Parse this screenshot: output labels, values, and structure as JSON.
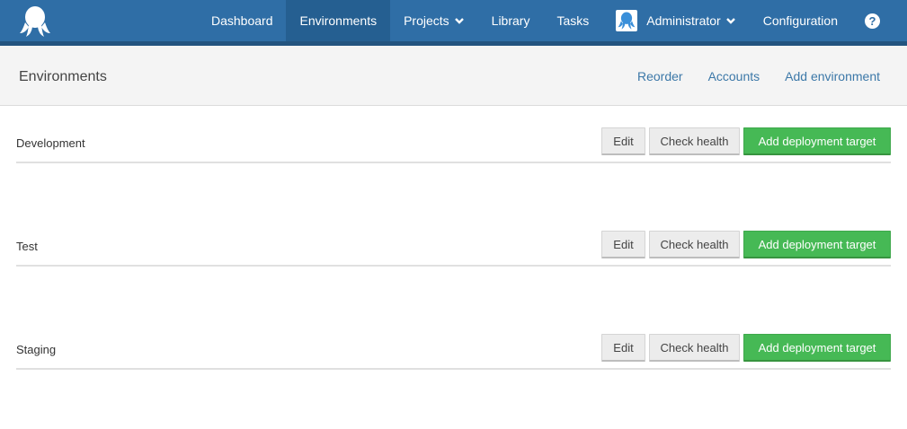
{
  "nav": {
    "items": [
      {
        "label": "Dashboard"
      },
      {
        "label": "Environments"
      },
      {
        "label": "Projects"
      },
      {
        "label": "Library"
      },
      {
        "label": "Tasks"
      },
      {
        "label": "Administrator"
      },
      {
        "label": "Configuration"
      }
    ],
    "help_label": "?",
    "active": "Environments"
  },
  "page": {
    "title": "Environments",
    "links": {
      "reorder": "Reorder",
      "accounts": "Accounts",
      "add_environment": "Add environment"
    }
  },
  "environments": [
    {
      "name": "Development",
      "edit": "Edit",
      "check_health": "Check health",
      "add_target": "Add deployment target"
    },
    {
      "name": "Test",
      "edit": "Edit",
      "check_health": "Check health",
      "add_target": "Add deployment target"
    },
    {
      "name": "Staging",
      "edit": "Edit",
      "check_health": "Check health",
      "add_target": "Add deployment target"
    }
  ],
  "colors": {
    "topbar": "#2f6ea6",
    "active_nav": "#255f91",
    "link": "#3c78a8",
    "primary_button": "#46b955"
  }
}
